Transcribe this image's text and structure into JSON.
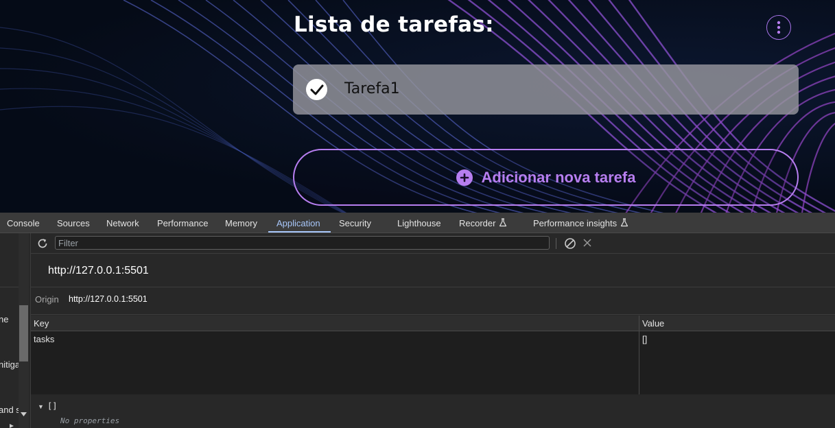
{
  "page": {
    "title": "Lista de tarefas:",
    "menu_icon": "more-vertical-icon",
    "tasks": [
      {
        "label": "Tarefa1",
        "done": true
      }
    ],
    "add_button_label": "Adicionar nova tarefa",
    "colors": {
      "accent": "#b77ef0",
      "background": "#071120"
    }
  },
  "devtools": {
    "tabs": [
      {
        "label": "Console",
        "active": false
      },
      {
        "label": "Sources",
        "active": false
      },
      {
        "label": "Network",
        "active": false
      },
      {
        "label": "Performance",
        "active": false
      },
      {
        "label": "Memory",
        "active": false
      },
      {
        "label": "Application",
        "active": true
      },
      {
        "label": "Security",
        "active": false
      },
      {
        "label": "Lighthouse",
        "active": false
      },
      {
        "label": "Recorder",
        "active": false,
        "experimental": true
      },
      {
        "label": "Performance insights",
        "active": false,
        "experimental": true
      }
    ],
    "sidebar_fragments": [
      "ne",
      "nitiga",
      "and s"
    ],
    "filter_placeholder": "Filter",
    "origin_heading": "http://127.0.0.1:5501",
    "origin_label": "Origin",
    "origin_value": "http://127.0.0.1:5501",
    "table": {
      "headers": {
        "key": "Key",
        "value": "Value"
      },
      "rows": [
        {
          "key": "tasks",
          "value": "[]"
        }
      ]
    },
    "preview": {
      "root": "[]",
      "empty_text": "No properties"
    },
    "colors": {
      "active_tab": "#a8c7fa",
      "panel_bg": "#282828"
    }
  }
}
